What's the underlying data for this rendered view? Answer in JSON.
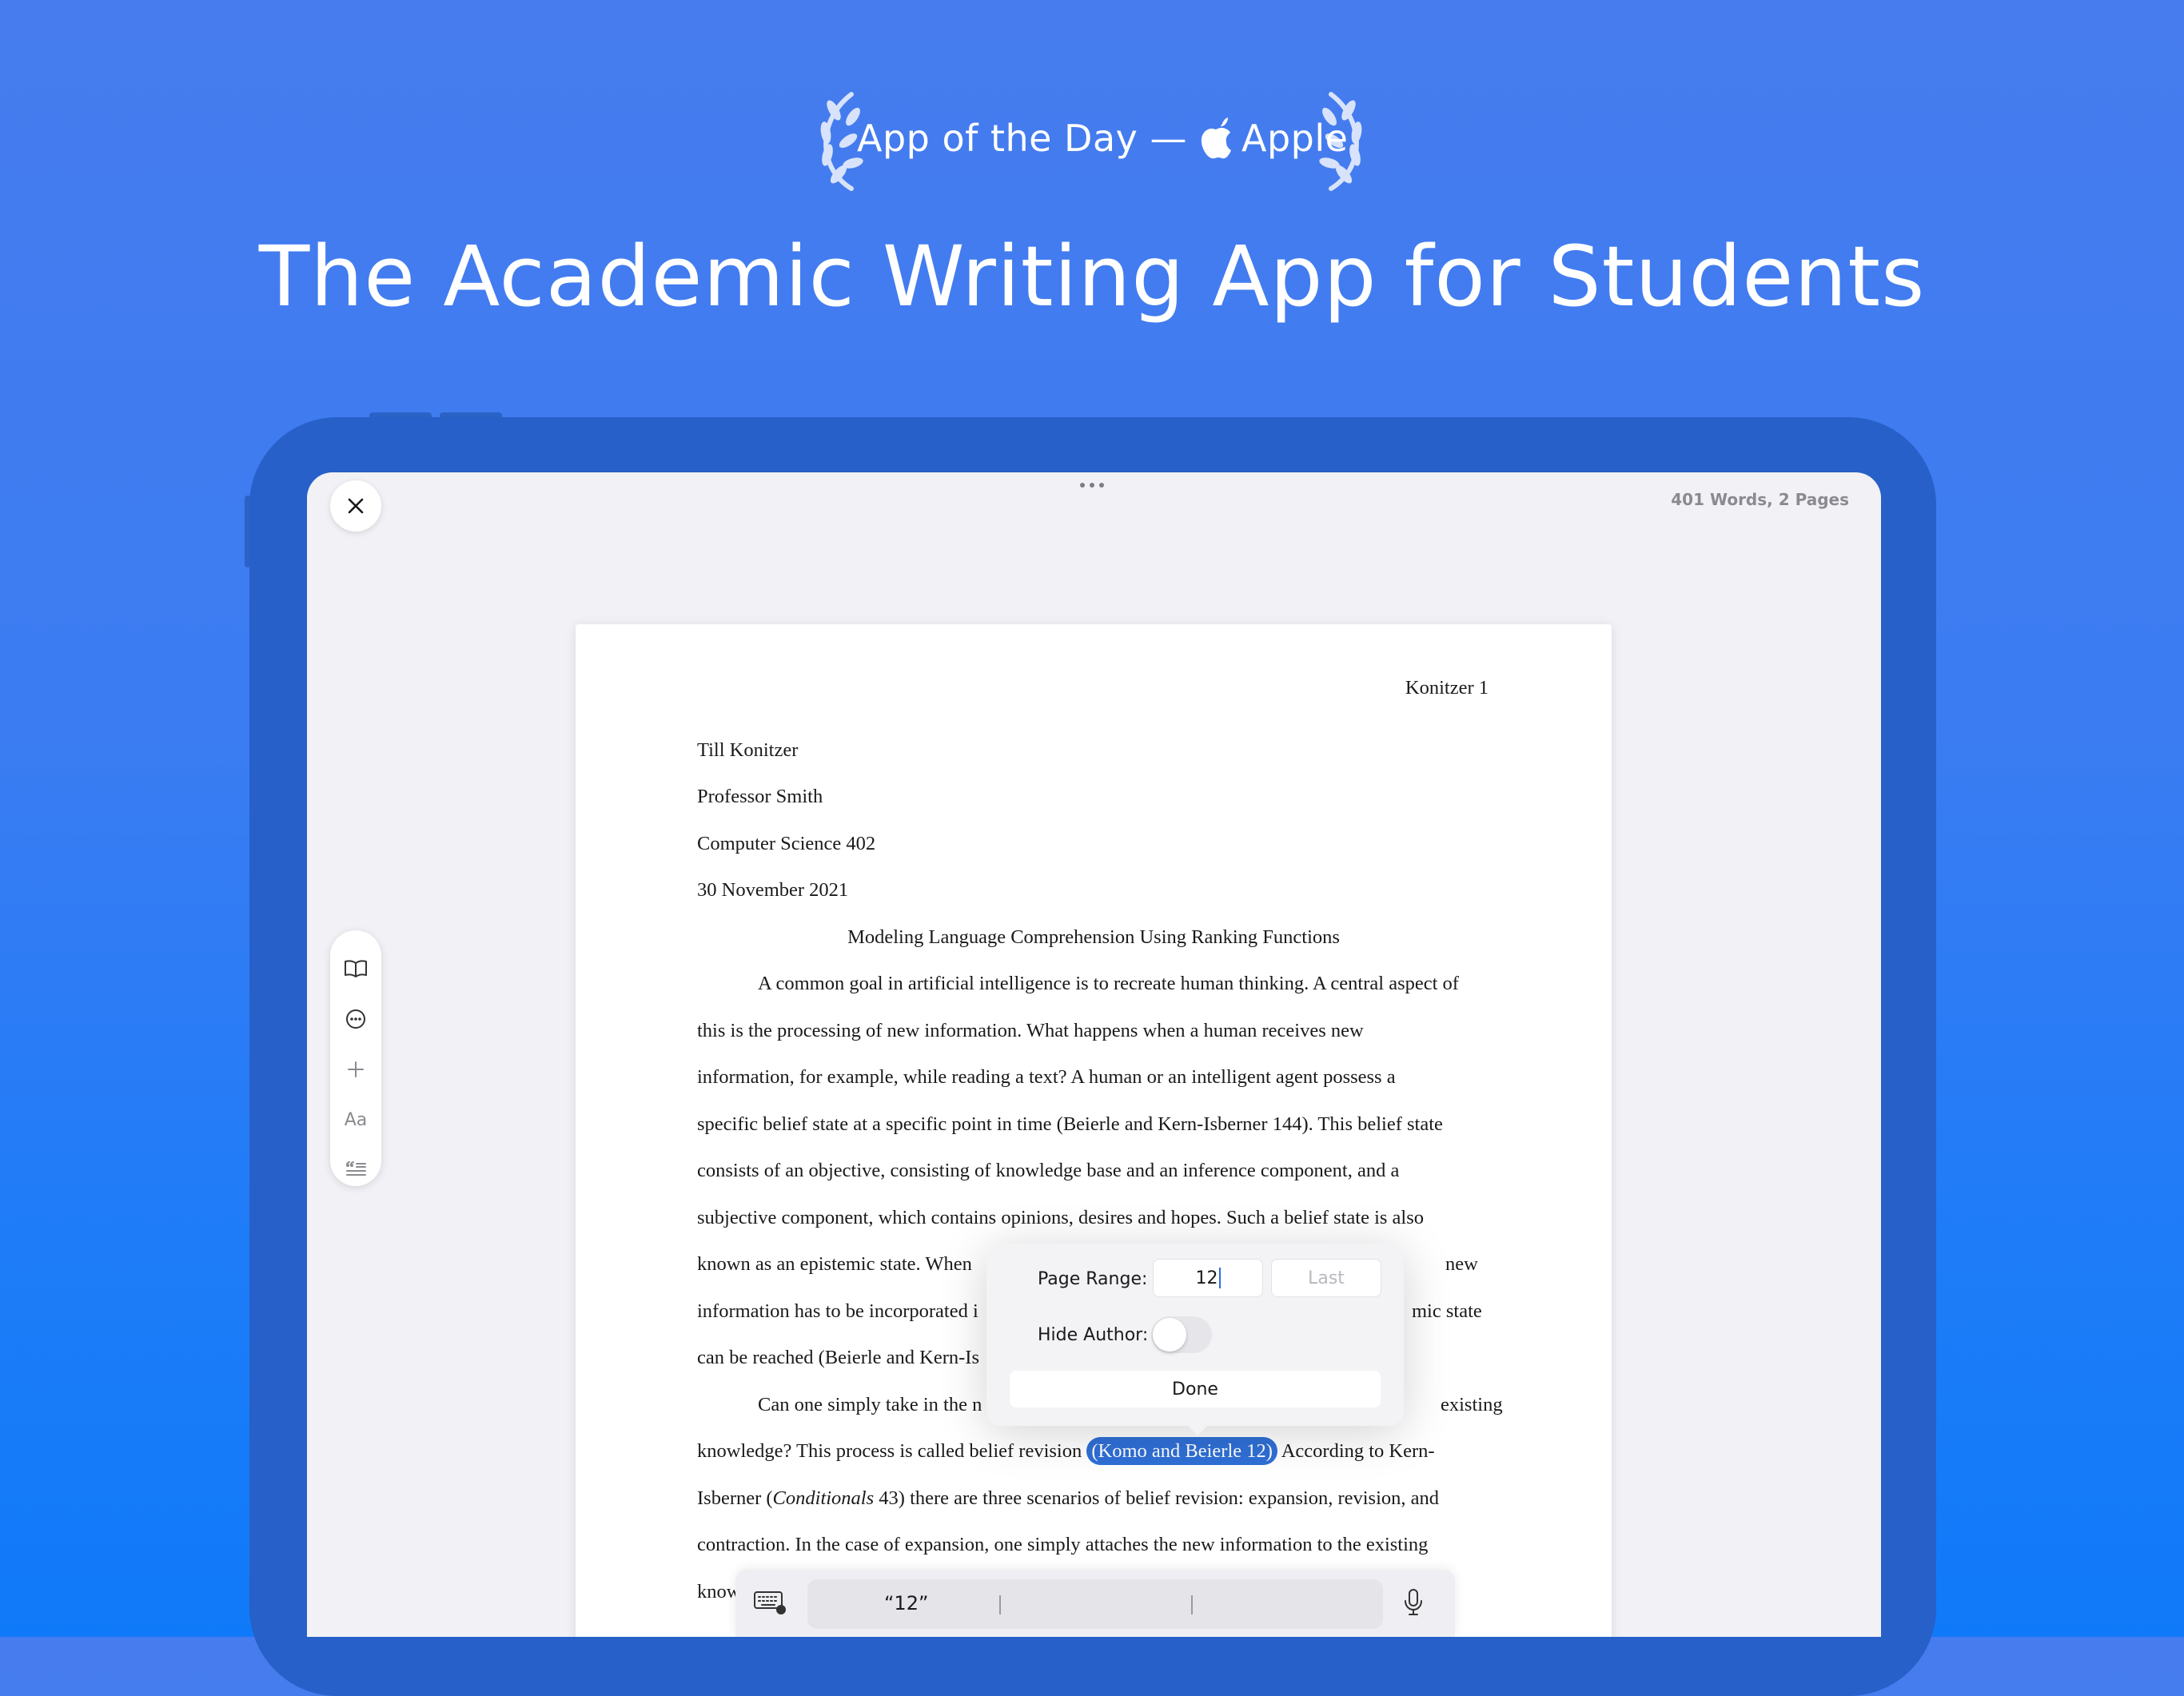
{
  "banner": {
    "award_text_left": "App of the Day —",
    "award_text_right": "Apple",
    "headline": "The Academic Writing App for Students"
  },
  "app": {
    "status": "401 Words, 2 Pages",
    "toolbar_icons": [
      "book-icon",
      "ellipsis-circle-icon",
      "plus-icon",
      "font-icon",
      "quote-list-icon"
    ],
    "font_button_label": "Aa"
  },
  "document": {
    "header": "Konitzer 1",
    "author": "Till Konitzer",
    "professor": "Professor Smith",
    "course": "Computer Science 402",
    "date": "30 November 2021",
    "title": "Modeling Language Comprehension Using Ranking Functions",
    "lines": [
      "A common goal in artificial intelligence is to recreate human thinking. A central aspect of",
      "this is the processing of new information. What happens when a human receives new",
      "information, for example, while reading a text? A human or an intelligent agent possess a",
      "specific belief state at a specific point in time (Beierle and Kern-Isberner 144). This belief state",
      "consists of an objective, consisting of knowledge base and an inference component, and a",
      "subjective component, which contains opinions, desires and hopes. Such a belief state is also",
      "known as an epistemic state. When",
      "information has to be incorporated i",
      "can be reached (Beierle and Kern-Is"
    ],
    "line7_tail": "new",
    "line8_tail": "mic state",
    "para2_line1_head": "Can one simply take in the n",
    "para2_line1_tail": "existing",
    "para2_line2_head": "knowledge? This process is called belief revision",
    "citation": "(Komo and Beierle 12)",
    "para2_line2_tail": "According to Kern-",
    "para2_line3_head": "Isberner (",
    "para2_line3_italic": "Conditionals",
    "para2_line3_tail": " 43) there are three scenarios of belief revision: expansion, revision, and",
    "para2_line4": "contraction. In the case of expansion, one simply attaches the new information to the existing",
    "para2_line5_head": "know"
  },
  "popover": {
    "page_range_label": "Page Range:",
    "page_range_value": "12",
    "last_placeholder": "Last",
    "hide_author_label": "Hide Author:",
    "hide_author_on": false,
    "done_label": "Done"
  },
  "keyboard": {
    "suggestion": "“12”"
  },
  "colors": {
    "background_top": "#467cee",
    "background_bottom": "#0f7af9",
    "device_frame": "#2760c8",
    "citation_highlight": "#2f6fd6"
  }
}
